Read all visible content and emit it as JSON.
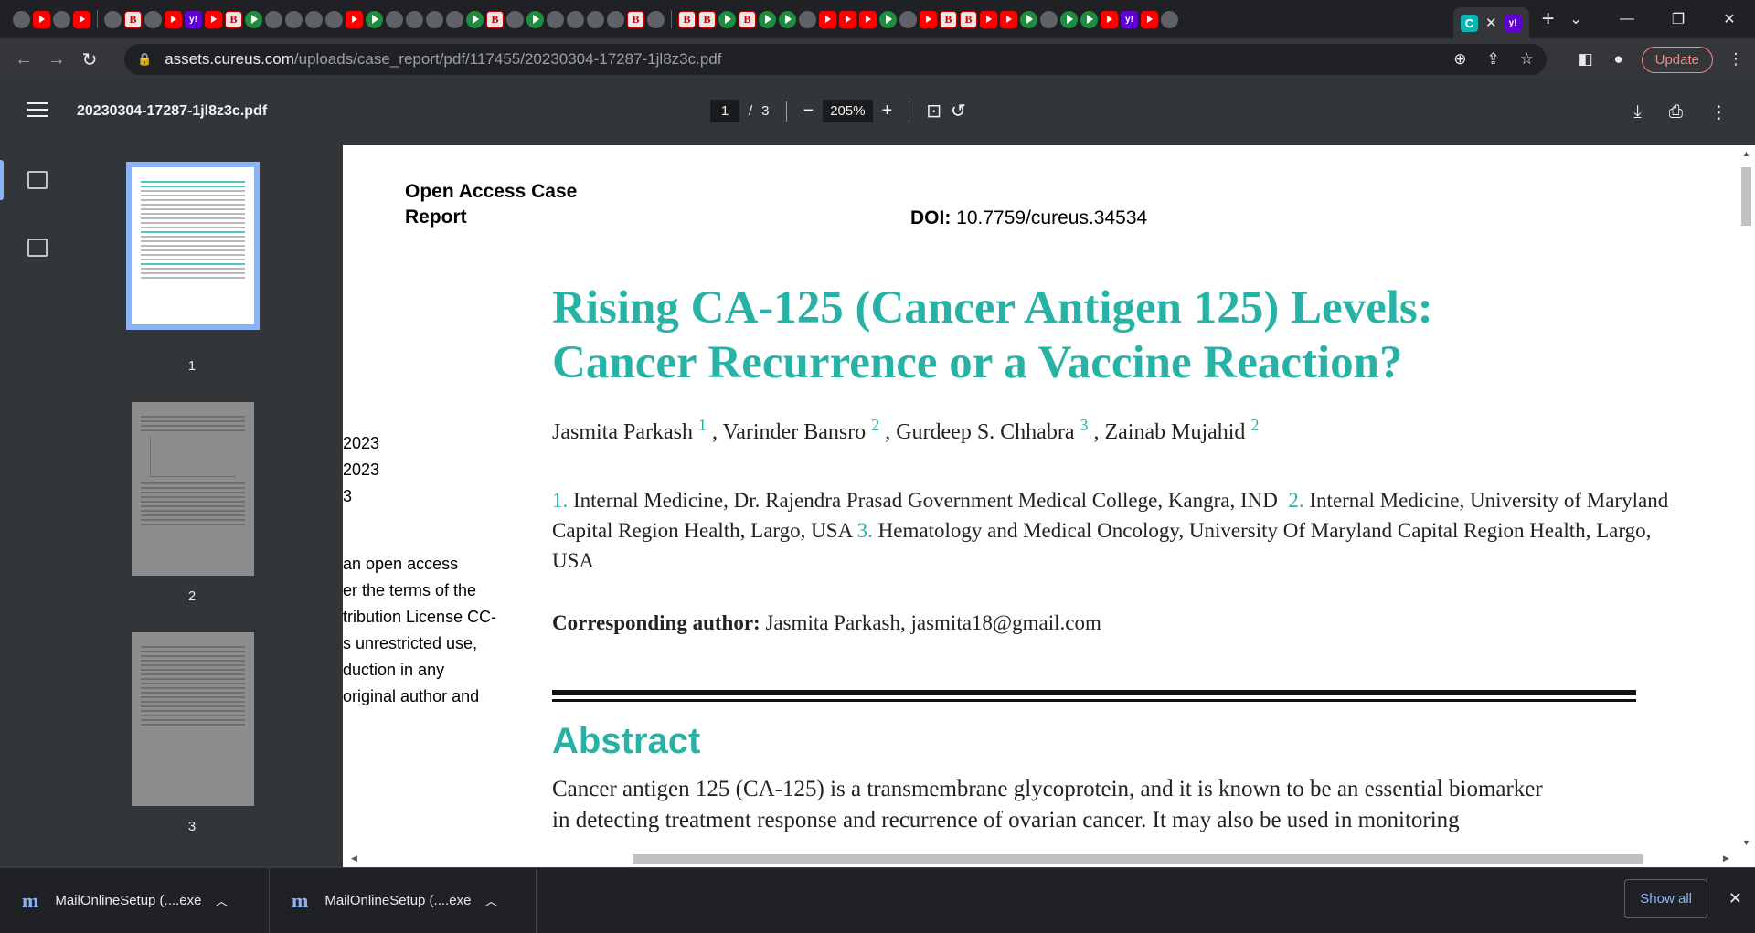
{
  "browser": {
    "active_tab_icon_letter": "C",
    "new_tab": "+",
    "url_host": "assets.cureus.com",
    "url_path": "/uploads/case_report/pdf/117455/20230304-17287-1jl8z3c.pdf",
    "update_label": "Update"
  },
  "pdf_viewer": {
    "file_name": "20230304-17287-1jl8z3c.pdf",
    "current_page": "1",
    "page_sep": "/",
    "total_pages": "3",
    "zoom": "205%",
    "thumbnails": [
      "1",
      "2",
      "3"
    ]
  },
  "document": {
    "access_type_line1": "Open Access Case",
    "access_type_line2": "Report",
    "doi_label": "DOI:",
    "doi_value": "10.7759/cureus.34534",
    "title_line1": "Rising CA-125 (Cancer Antigen 125) Levels:",
    "title_line2": "Cancer Recurrence or a Vaccine Reaction?",
    "authors": [
      {
        "name": "Jasmita Parkash",
        "aff": "1"
      },
      {
        "name": "Varinder Bansro",
        "aff": "2"
      },
      {
        "name": "Gurdeep S. Chhabra",
        "aff": "3"
      },
      {
        "name": "Zainab Mujahid",
        "aff": "2"
      }
    ],
    "affiliations": [
      {
        "num": "1.",
        "text": "Internal Medicine, Dr. Rajendra Prasad Government Medical College, Kangra, IND"
      },
      {
        "num": "2.",
        "text": "Internal Medicine, University of Maryland Capital Region Health, Largo, USA"
      },
      {
        "num": "3.",
        "text": "Hematology and Medical Oncology, University Of Maryland Capital Region Health, Largo, USA"
      }
    ],
    "corresponding_label": "Corresponding author:",
    "corresponding_value": "Jasmita Parkash, jasmita18@gmail.com",
    "abstract_heading": "Abstract",
    "abstract_line1": "Cancer antigen 125 (CA-125) is a transmembrane glycoprotein, and it is known to be an essential biomarker",
    "abstract_line2": "in detecting treatment response and recurrence of ovarian cancer. It may also be used in monitoring",
    "side_column": [
      "2023",
      "2023",
      "3",
      "an open access",
      "er the terms of the",
      "tribution License CC-",
      "s unrestricted use,",
      "duction in any",
      " original author and"
    ]
  },
  "downloads": {
    "items": [
      {
        "name": "MailOnlineSetup (....exe"
      },
      {
        "name": "MailOnlineSetup (....exe"
      }
    ],
    "show_all": "Show all"
  }
}
